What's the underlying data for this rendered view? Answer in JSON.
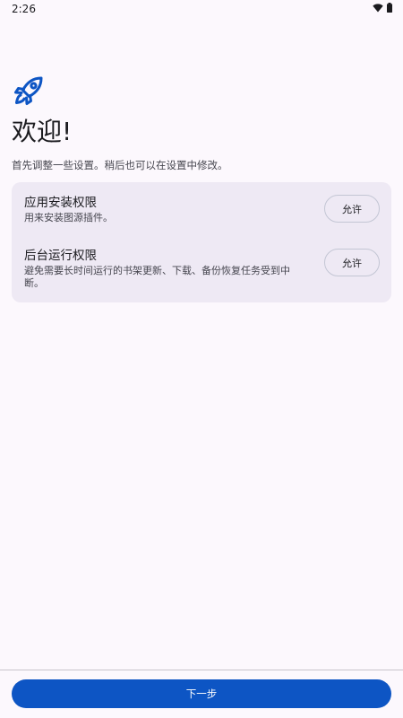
{
  "status_bar": {
    "time": "2:26",
    "icons": [
      "wifi-icon",
      "battery-icon"
    ]
  },
  "welcome": {
    "icon": "rocket-icon",
    "title": "欢迎!",
    "subtitle": "首先调整一些设置。稍后也可以在设置中修改。"
  },
  "permissions": [
    {
      "title": "应用安装权限",
      "description": "用来安装图源插件。",
      "button_label": "允许"
    },
    {
      "title": "后台运行权限",
      "description": "避免需要长时间运行的书架更新、下载、备份恢复任务受到中断。",
      "button_label": "允许"
    }
  ],
  "footer": {
    "next_label": "下一步"
  },
  "colors": {
    "background": "#FCF8FD",
    "card": "#EEE9F4",
    "primary": "#0D55C4",
    "on_surface": "#1B1B1F"
  }
}
